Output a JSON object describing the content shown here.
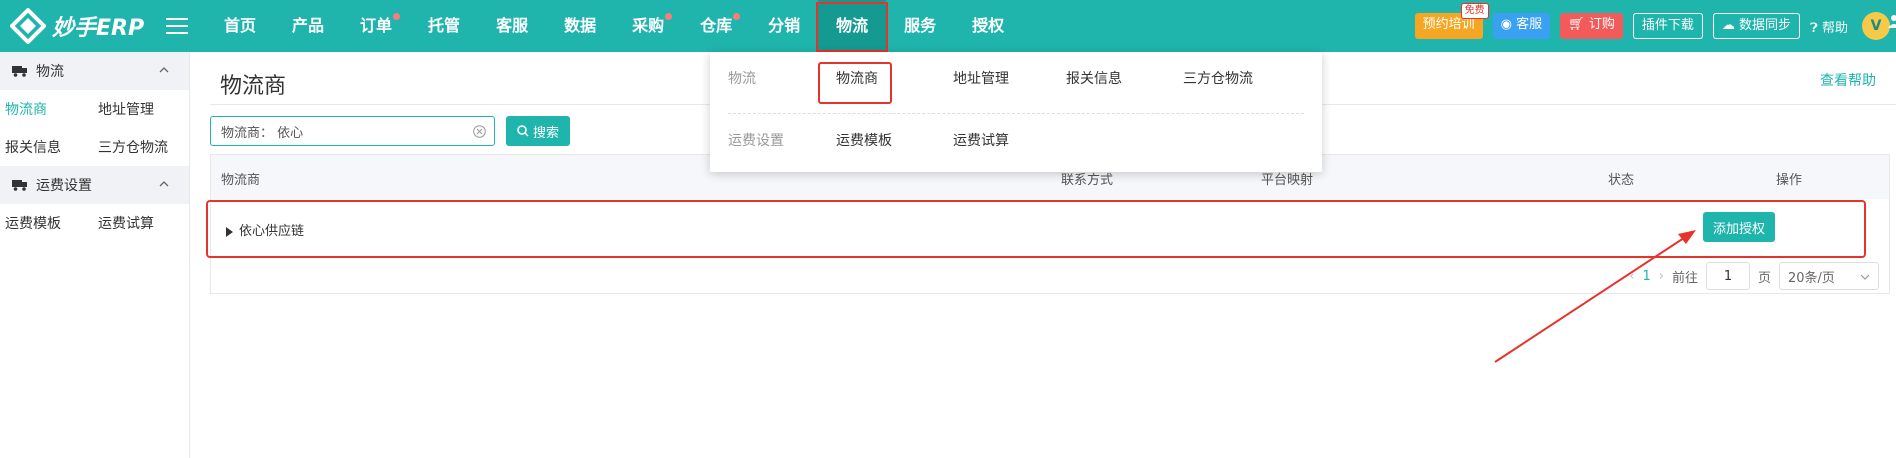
{
  "app": {
    "logo_text": "妙手ERP",
    "brand_color": "#1fb5ad",
    "accent_red": "#e8322c"
  },
  "nav": {
    "items": [
      {
        "label": "首页",
        "dot": false
      },
      {
        "label": "产品",
        "dot": false
      },
      {
        "label": "订单",
        "dot": true
      },
      {
        "label": "托管",
        "dot": false
      },
      {
        "label": "客服",
        "dot": false
      },
      {
        "label": "数据",
        "dot": false
      },
      {
        "label": "采购",
        "dot": true
      },
      {
        "label": "仓库",
        "dot": true
      },
      {
        "label": "分销",
        "dot": false
      },
      {
        "label": "物流",
        "dot": false,
        "active": true
      },
      {
        "label": "服务",
        "dot": false
      },
      {
        "label": "授权",
        "dot": false
      }
    ]
  },
  "toolbar": {
    "training": "预约培训",
    "training_badge": "免费",
    "service": "客服",
    "subscribe": "订购",
    "plugin": "插件下载",
    "sync": "数据同步",
    "help": "帮助",
    "avatar": "V"
  },
  "sidebar": {
    "group1": {
      "label": "物流",
      "items": [
        "物流商",
        "地址管理",
        "报关信息",
        "三方仓物流"
      ]
    },
    "group2": {
      "label": "运费设置",
      "items": [
        "运费模板",
        "运费试算"
      ]
    }
  },
  "main": {
    "title": "物流商",
    "help_link": "查看帮助",
    "search_value": "物流商：  依心",
    "search_button": "搜索",
    "columns": [
      "物流商",
      "联系方式",
      "平台映射",
      "状态",
      "操作"
    ],
    "rows": [
      {
        "name": "依心供应链",
        "action": "添加授权"
      }
    ],
    "pager": {
      "page": "1",
      "goto_label": "前往",
      "goto_value": "1",
      "page_suffix": "页",
      "page_size": "20条/页"
    }
  },
  "dropdown": {
    "group1_label": "物流",
    "group1_items": [
      "物流商",
      "地址管理",
      "报关信息",
      "三方仓物流"
    ],
    "group2_label": "运费设置",
    "group2_items": [
      "运费模板",
      "运费试算"
    ]
  }
}
